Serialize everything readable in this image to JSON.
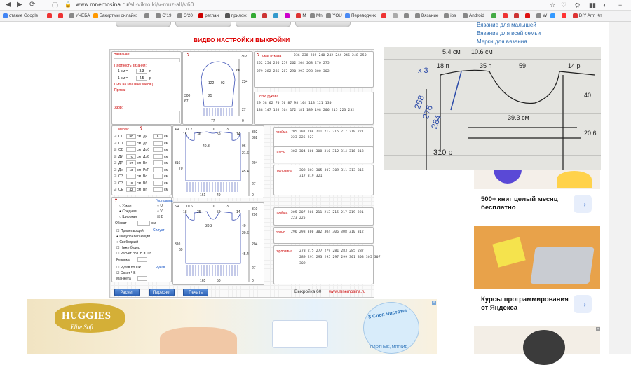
{
  "browser": {
    "url_prefix": "www.mnemosina.ru",
    "url_rest": "/all-vikroiki/v-muz-all/v60"
  },
  "bookmarks": [
    {
      "label": "стакие Google",
      "color": "#4285f4"
    },
    {
      "label": "",
      "color": "#e33"
    },
    {
      "label": "",
      "color": "#e33"
    },
    {
      "label": "УЧЕБА",
      "color": "#888"
    },
    {
      "label": "Бакиртмы онлайн:",
      "color": "#f90"
    },
    {
      "label": "",
      "color": "#888"
    },
    {
      "label": "O'19",
      "color": "#888"
    },
    {
      "label": "O'20",
      "color": "#888"
    },
    {
      "label": "реглан",
      "color": "#c00"
    },
    {
      "label": "прилож",
      "color": "#555"
    },
    {
      "label": "",
      "color": "#3a3"
    },
    {
      "label": "",
      "color": "#c33"
    },
    {
      "label": "",
      "color": "#39c"
    },
    {
      "label": "",
      "color": "#c0c"
    },
    {
      "label": "M",
      "color": "#d33"
    },
    {
      "label": "Mn",
      "color": "#888"
    },
    {
      "label": "YOU",
      "color": "#888"
    },
    {
      "label": "Переводчик",
      "color": "#4a8af4"
    },
    {
      "label": "",
      "color": "#e33"
    },
    {
      "label": "",
      "color": "#aaa"
    },
    {
      "label": "",
      "color": "#888"
    },
    {
      "label": "Вязание",
      "color": "#888"
    },
    {
      "label": "ios",
      "color": "#888"
    },
    {
      "label": "Android",
      "color": "#888"
    },
    {
      "label": "",
      "color": "#4a4"
    },
    {
      "label": "",
      "color": "#e33"
    },
    {
      "label": "",
      "color": "#c33"
    },
    {
      "label": "",
      "color": "#d11"
    },
    {
      "label": "W",
      "color": "#888"
    },
    {
      "label": "",
      "color": "#39f"
    },
    {
      "label": "",
      "color": "#f33"
    },
    {
      "label": "DIY Arm Kn",
      "color": "#d33"
    }
  ],
  "calc": {
    "video_title": "ВИДЕО НАСТРОЙКИ ВЫКРОЙКИ",
    "name_label": "Название:",
    "density_label": "Плотность вязания:",
    "density_rows": [
      {
        "unit": "1 см =",
        "value": "3.3",
        "suffix": "п"
      },
      {
        "unit": "1 см =",
        "value": "4.5",
        "suffix": "р"
      }
    ],
    "machine_label": "П-ть на машине/ Месяц",
    "yarn_label": "Пряжа:",
    "pattern_label": "Узор:",
    "measures_title": "Мерки:",
    "measures": [
      {
        "code": "ОГ",
        "v": "90",
        "code2": "Ди",
        "v2": "9"
      },
      {
        "code": "ОТ",
        "v": "",
        "code2": "Дп",
        "v2": ""
      },
      {
        "code": "ОБ",
        "v": "",
        "code2": "Доб",
        "v2": ""
      },
      {
        "code": "ДИ",
        "v": "70",
        "code2": "Дэ6",
        "v2": ""
      },
      {
        "code": "ДР",
        "v": "67",
        "code2": "Вп",
        "v2": ""
      },
      {
        "code": "Дк",
        "v": "13",
        "code2": "РкГ",
        "v2": ""
      },
      {
        "code": "ОЗ",
        "v": "",
        "code2": "Вс",
        "v2": ""
      },
      {
        "code": "ОЗ",
        "v": "18",
        "code2": "Вб",
        "v2": ""
      },
      {
        "code": "ОЕ",
        "v": "42",
        "code2": "Вп",
        "v2": ""
      }
    ],
    "unit_cm": "см",
    "fit_title": "Горловина",
    "fit_options": [
      "Узкая",
      "Средняя",
      "Широкая"
    ],
    "neck_options": [
      "U",
      "V",
      "B"
    ],
    "ease_label": "Обхват",
    "style_title": "Силуэт",
    "style_options": [
      "Прилегающий",
      "Полуприлегающий",
      "Свободный",
      "Ниже бедер",
      "Расчет по ОБ и Шп"
    ],
    "ease2_label": "Резинка",
    "sleeve_title": "Рукав",
    "sleeve_options": [
      "Рукав по ОР",
      "Оскат ЧВ"
    ],
    "cuff_label": "Манжета",
    "buttons": {
      "calc": "Расчет",
      "recalc": "Пересчет",
      "print": "Печать"
    },
    "model_id": "Выкройка 60",
    "site": "www.mnemosina.ru",
    "sleeve_cap_title": "окат рукава",
    "sleeve_cap_rows": [
      "236 238 239 240 242 244 246 248 250",
      "252 254 256 259 262 264 268 270 275",
      "279 282 285 287 290 293 298 300 302"
    ],
    "sleeve_bevel_title": "скос рукава",
    "sleeve_bevel_rows": [
      "29  58  62  70  70  87  98 104 113 121 130",
      "138 147 155 164 172 181 189 198 206 215 223 232"
    ],
    "armhole_title": "пройма",
    "armhole_rows": [
      "205 207 208 211 213 215 217 219 221",
      "223 225 227"
    ],
    "shoulder_title": "плечо",
    "shoulder_rows": [
      "302 304 306 308 310 312 314 316 318"
    ],
    "neckline_title": "горловина",
    "neckline_rows": [
      "302 303 305 307 309 311 313 315",
      "317 319 321"
    ],
    "armhole2_rows": [
      "205 207 208 211 213 215 217 219 221",
      "223 225"
    ],
    "shoulder2_rows": [
      "296 298 300 302 304 306 308 310 312"
    ],
    "neckline2_rows": [
      "273 275 277 279 281 283 285 287",
      "289 291 293 295 297 299 301 303 305 307",
      "309"
    ],
    "sleeve_diagram": {
      "top": "302",
      "a": "66",
      "b": "234",
      "c": "122",
      "d": "92",
      "e": "25",
      "f": "300",
      "g": "67",
      "h": "27",
      "i": "77",
      "j": "0"
    },
    "back_diagram": {
      "w1": "4.4",
      "w2": "11.7",
      "w3": "10",
      "w4": "3",
      "a": "15",
      "b": "36",
      "c": "59",
      "d": "14",
      "h1": "316",
      "h2": "302",
      "r1": "40.3",
      "r2": "96",
      "r3": "21.6",
      "h3": "204",
      "h4": "45.4",
      "h5": "27",
      "h6": "0",
      "base": "161",
      "base2": "49",
      "side": "70"
    },
    "front_diagram": {
      "w1": "5.4",
      "w2": "10.6",
      "w3": "10",
      "w4": "3",
      "a": "18",
      "b": "35",
      "c": "59",
      "d": "14",
      "h1": "310",
      "h2": "296",
      "r1": "39.3",
      "r2": "40",
      "r3": "20.6",
      "h3": "204",
      "h4": "45.4",
      "h5": "27",
      "h6": "0",
      "base": "165",
      "base2": "50",
      "side": "69"
    }
  },
  "sidebar": {
    "links": [
      "Вязание для малышей",
      "Вязание для всей семьи",
      "Мерки для вязания"
    ],
    "photo": {
      "labels": [
        "5.4 см",
        "10.6 см",
        "18 п",
        "35 п",
        "59",
        "14 р",
        "39.3 см",
        "40",
        "20.6",
        "310 р",
        "x 3",
        "268",
        "276",
        "284"
      ]
    },
    "cards": [
      {
        "title": "500+ книг целый месяц бесплатно"
      },
      {
        "title": "Курсы программирования от Яндекса"
      }
    ]
  },
  "ad": {
    "brand": "HUGGIES",
    "sub": "Elite Soft",
    "badge": "3 Слоя Чистоты",
    "bottom": "ПЛОТНЫЕ, МЯГКИЕ"
  }
}
